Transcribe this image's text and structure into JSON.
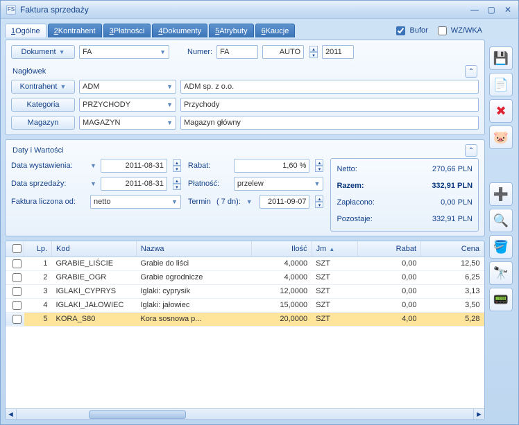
{
  "window": {
    "icon": "FS",
    "title": "Faktura sprzedaży"
  },
  "tabs": [
    {
      "num": "1",
      "label": "Ogólne",
      "active": true
    },
    {
      "num": "2",
      "label": "Kontrahent"
    },
    {
      "num": "3",
      "label": "Płatności"
    },
    {
      "num": "4",
      "label": "Dokumenty"
    },
    {
      "num": "5",
      "label": "Atrybuty"
    },
    {
      "num": "6",
      "label": "Kaucje"
    }
  ],
  "checks": {
    "bufor_label": "Bufor",
    "bufor_checked": true,
    "wzwka_label": "WZ/WKA",
    "wzwka_checked": false
  },
  "dokument": {
    "btn": "Dokument",
    "type": "FA",
    "numer_label": "Numer:",
    "numer_prefix": "FA",
    "auto": "AUTO",
    "year": "2011"
  },
  "naglowek": {
    "title": "Nagłówek",
    "kontrahent_btn": "Kontrahent",
    "kontrahent_code": "ADM",
    "kontrahent_name": "ADM sp. z o.o.",
    "kategoria_btn": "Kategoria",
    "kategoria_code": "PRZYCHODY",
    "kategoria_name": "Przychody",
    "magazyn_btn": "Magazyn",
    "magazyn_code": "MAGAZYN",
    "magazyn_name": "Magazyn główny"
  },
  "daty": {
    "title": "Daty i Wartości",
    "data_wyst_lbl": "Data wystawienia:",
    "data_wyst": "2011-08-31",
    "data_sprz_lbl": "Data sprzedaży:",
    "data_sprz": "2011-08-31",
    "faktura_od_lbl": "Faktura liczona od:",
    "faktura_od": "netto",
    "rabat_lbl": "Rabat:",
    "rabat": "1,60 %",
    "platnosc_lbl": "Płatność:",
    "platnosc": "przelew",
    "termin_lbl": "Termin",
    "termin_dni": "(   7 dn):",
    "termin_data": "2011-09-07",
    "netto_lbl": "Netto:",
    "netto_val": "270,66 PLN",
    "razem_lbl": "Razem:",
    "razem_val": "332,91 PLN",
    "zaplacono_lbl": "Zapłacono:",
    "zaplacono_val": "0,00 PLN",
    "pozostaje_lbl": "Pozostaje:",
    "pozostaje_val": "332,91 PLN"
  },
  "grid": {
    "cols": {
      "lp": "Lp.",
      "kod": "Kod",
      "nazwa": "Nazwa",
      "ilosc": "Ilość",
      "jm": "Jm",
      "rabat": "Rabat",
      "cena": "Cena"
    },
    "rows": [
      {
        "lp": "1",
        "kod": "GRABIE_LIŚCIE",
        "nazwa": "Grabie do liści",
        "ilosc": "4,0000",
        "jm": "SZT",
        "rabat": "0,00",
        "cena": "12,50",
        "sel": false
      },
      {
        "lp": "2",
        "kod": "GRABIE_OGR",
        "nazwa": "Grabie ogrodnicze",
        "ilosc": "4,0000",
        "jm": "SZT",
        "rabat": "0,00",
        "cena": "6,25",
        "sel": false
      },
      {
        "lp": "3",
        "kod": "IGLAKI_CYPRYS",
        "nazwa": "Iglaki: cyprysik",
        "ilosc": "12,0000",
        "jm": "SZT",
        "rabat": "0,00",
        "cena": "3,13",
        "sel": false
      },
      {
        "lp": "4",
        "kod": "IGLAKI_JAŁOWIEC",
        "nazwa": "Iglaki: jałowiec",
        "ilosc": "15,0000",
        "jm": "SZT",
        "rabat": "0,00",
        "cena": "3,50",
        "sel": false
      },
      {
        "lp": "5",
        "kod": "KORA_S80",
        "nazwa": "Kora sosnowa p...",
        "ilosc": "20,0000",
        "jm": "SZT",
        "rabat": "4,00",
        "cena": "5,28",
        "sel": true
      }
    ]
  },
  "side_icons": [
    "save",
    "edit-doc",
    "delete",
    "piggy",
    "add",
    "search",
    "bucket",
    "binoculars",
    "calculator"
  ],
  "icon_glyph": {
    "save": "💾",
    "edit-doc": "📄",
    "delete": "✖",
    "piggy": "🐷",
    "add": "➕",
    "search": "🔍",
    "bucket": "🪣",
    "binoculars": "🔭",
    "calculator": "📟"
  }
}
